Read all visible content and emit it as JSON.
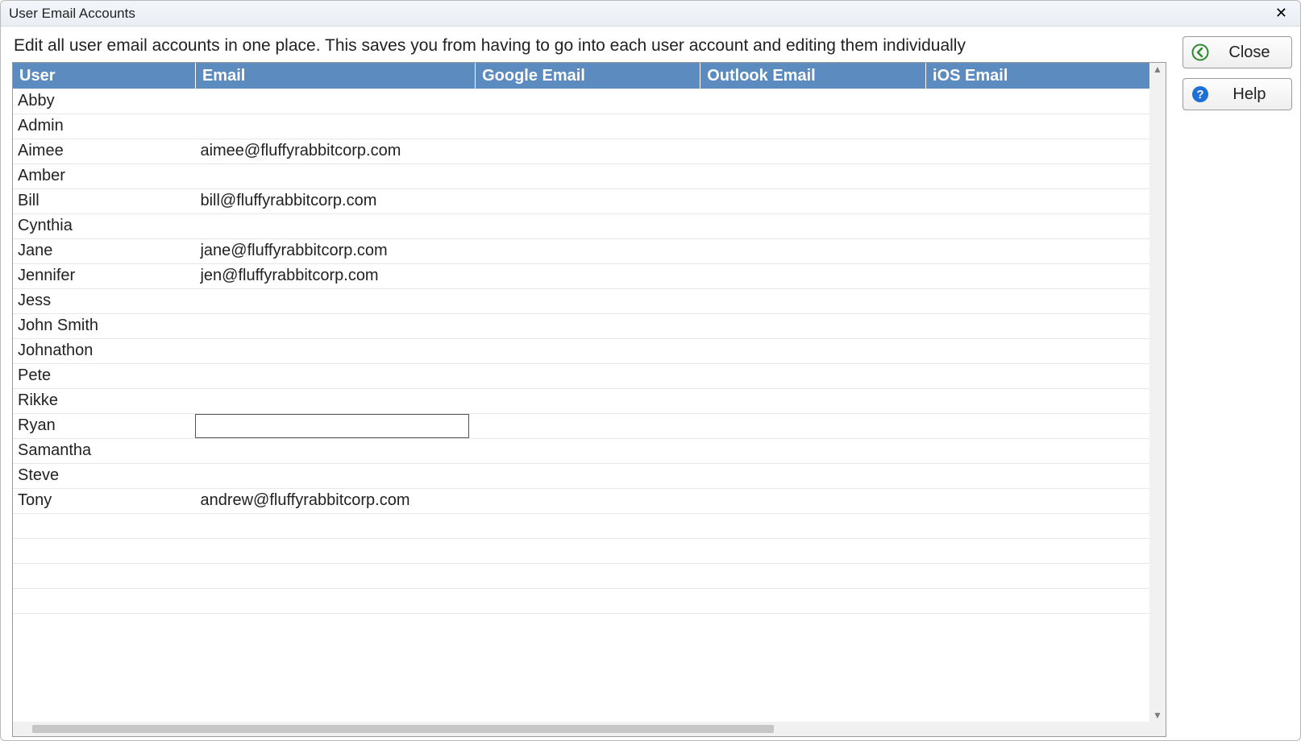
{
  "window": {
    "title": "User Email Accounts"
  },
  "description": "Edit all user email accounts in one place. This saves you from having to go into each user account and editing them individually",
  "buttons": {
    "close": "Close",
    "help": "Help"
  },
  "table": {
    "columns": {
      "user": "User",
      "email": "Email",
      "google_email": "Google Email",
      "outlook_email": "Outlook Email",
      "ios_email": "iOS Email"
    },
    "editing_row_index": 13,
    "editing_column": "email",
    "editing_value": "",
    "rows": [
      {
        "user": "Abby",
        "email": "",
        "google_email": "",
        "outlook_email": "",
        "ios_email": ""
      },
      {
        "user": "Admin",
        "email": "",
        "google_email": "",
        "outlook_email": "",
        "ios_email": ""
      },
      {
        "user": "Aimee",
        "email": "aimee@fluffyrabbitcorp.com",
        "google_email": "",
        "outlook_email": "",
        "ios_email": ""
      },
      {
        "user": "Amber",
        "email": "",
        "google_email": "",
        "outlook_email": "",
        "ios_email": ""
      },
      {
        "user": "Bill",
        "email": "bill@fluffyrabbitcorp.com",
        "google_email": "",
        "outlook_email": "",
        "ios_email": ""
      },
      {
        "user": "Cynthia",
        "email": "",
        "google_email": "",
        "outlook_email": "",
        "ios_email": ""
      },
      {
        "user": "Jane",
        "email": "jane@fluffyrabbitcorp.com",
        "google_email": "",
        "outlook_email": "",
        "ios_email": ""
      },
      {
        "user": "Jennifer",
        "email": "jen@fluffyrabbitcorp.com",
        "google_email": "",
        "outlook_email": "",
        "ios_email": ""
      },
      {
        "user": "Jess",
        "email": "",
        "google_email": "",
        "outlook_email": "",
        "ios_email": ""
      },
      {
        "user": "John Smith",
        "email": "",
        "google_email": "",
        "outlook_email": "",
        "ios_email": ""
      },
      {
        "user": "Johnathon",
        "email": "",
        "google_email": "",
        "outlook_email": "",
        "ios_email": ""
      },
      {
        "user": "Pete",
        "email": "",
        "google_email": "",
        "outlook_email": "",
        "ios_email": ""
      },
      {
        "user": "Rikke",
        "email": "",
        "google_email": "",
        "outlook_email": "",
        "ios_email": ""
      },
      {
        "user": "Ryan",
        "email": "",
        "google_email": "",
        "outlook_email": "",
        "ios_email": ""
      },
      {
        "user": "Samantha",
        "email": "",
        "google_email": "",
        "outlook_email": "",
        "ios_email": ""
      },
      {
        "user": "Steve",
        "email": "",
        "google_email": "",
        "outlook_email": "",
        "ios_email": ""
      },
      {
        "user": "Tony",
        "email": "andrew@fluffyrabbitcorp.com",
        "google_email": "",
        "outlook_email": "",
        "ios_email": ""
      }
    ]
  }
}
